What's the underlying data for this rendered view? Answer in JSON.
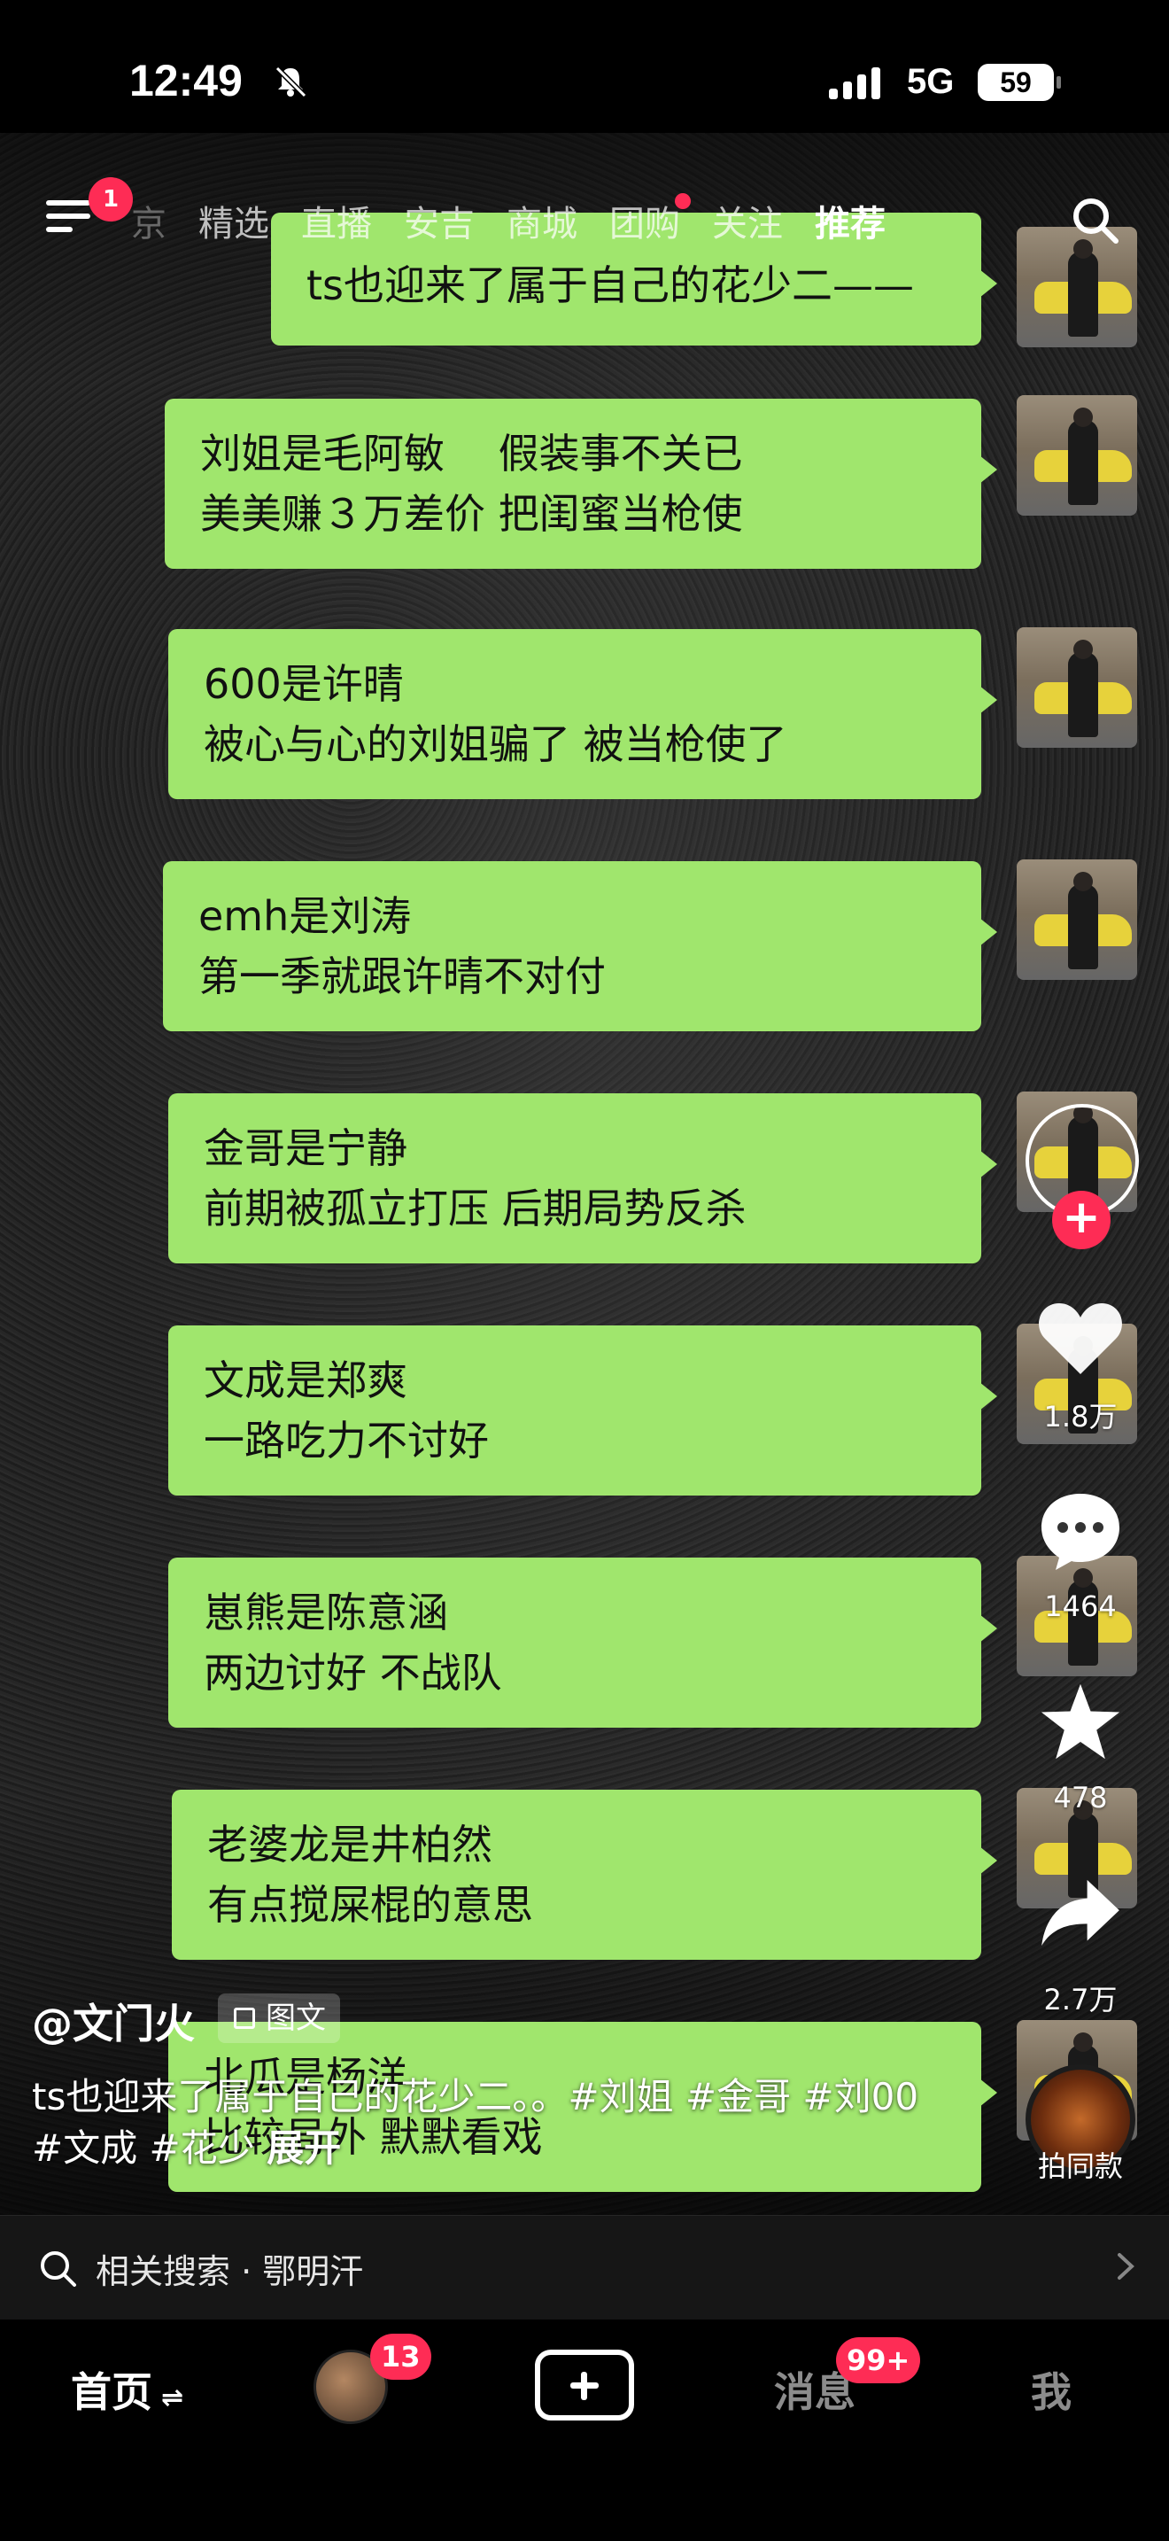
{
  "status_bar": {
    "time": "12:49",
    "network": "5G",
    "battery": "59"
  },
  "top_nav": {
    "menu_badge": "1",
    "tabs": [
      {
        "label": "京",
        "state": "partial"
      },
      {
        "label": "精选",
        "state": "normal"
      },
      {
        "label": "直播",
        "state": "normal"
      },
      {
        "label": "安吉",
        "state": "normal"
      },
      {
        "label": "商城",
        "state": "normal"
      },
      {
        "label": "团购",
        "state": "dot"
      },
      {
        "label": "关注",
        "state": "normal"
      },
      {
        "label": "推荐",
        "state": "active"
      }
    ]
  },
  "messages": [
    {
      "lines": [
        "ts也迎来了属于自己的花少二——"
      ]
    },
    {
      "lines": [
        "刘姐是毛阿敏　 假装事不关已",
        "美美赚３万差价 把闺蜜当枪使"
      ]
    },
    {
      "lines": [
        "600是许晴",
        "被心与心的刘姐骗了 被当枪使了"
      ]
    },
    {
      "lines": [
        "emh是刘涛",
        "第一季就跟许晴不对付"
      ]
    },
    {
      "lines": [
        "金哥是宁静",
        "前期被孤立打压 后期局势反杀"
      ]
    },
    {
      "lines": [
        "文成是郑爽",
        "一路吃力不讨好"
      ]
    },
    {
      "lines": [
        "崽熊是陈意涵",
        "两边讨好 不战队"
      ]
    },
    {
      "lines": [
        "老婆龙是井柏然",
        "有点搅屎棍的意思"
      ]
    },
    {
      "lines": [
        "北瓜是杨洋",
        "比较局外 默默看戏"
      ]
    }
  ],
  "rail": {
    "likes": "1.8万",
    "comments": "1464",
    "favorites": "478",
    "shares": "2.7万",
    "music_label": "拍同款"
  },
  "post": {
    "author": "@文门火",
    "type_tag": "图文",
    "caption": "ts也迎来了属于自己的花少二。。#刘姐 #金哥 #刘00 #文成 #花少",
    "expand": "展开"
  },
  "related_search": {
    "text": "相关搜索 · 鄂明汗"
  },
  "bottom_bar": {
    "home": "首页",
    "friends_badge": "13",
    "messages": "消息",
    "messages_badge": "99+",
    "me": "我"
  },
  "colors": {
    "bubble": "#a0e66d",
    "accent": "#fe2c55"
  }
}
